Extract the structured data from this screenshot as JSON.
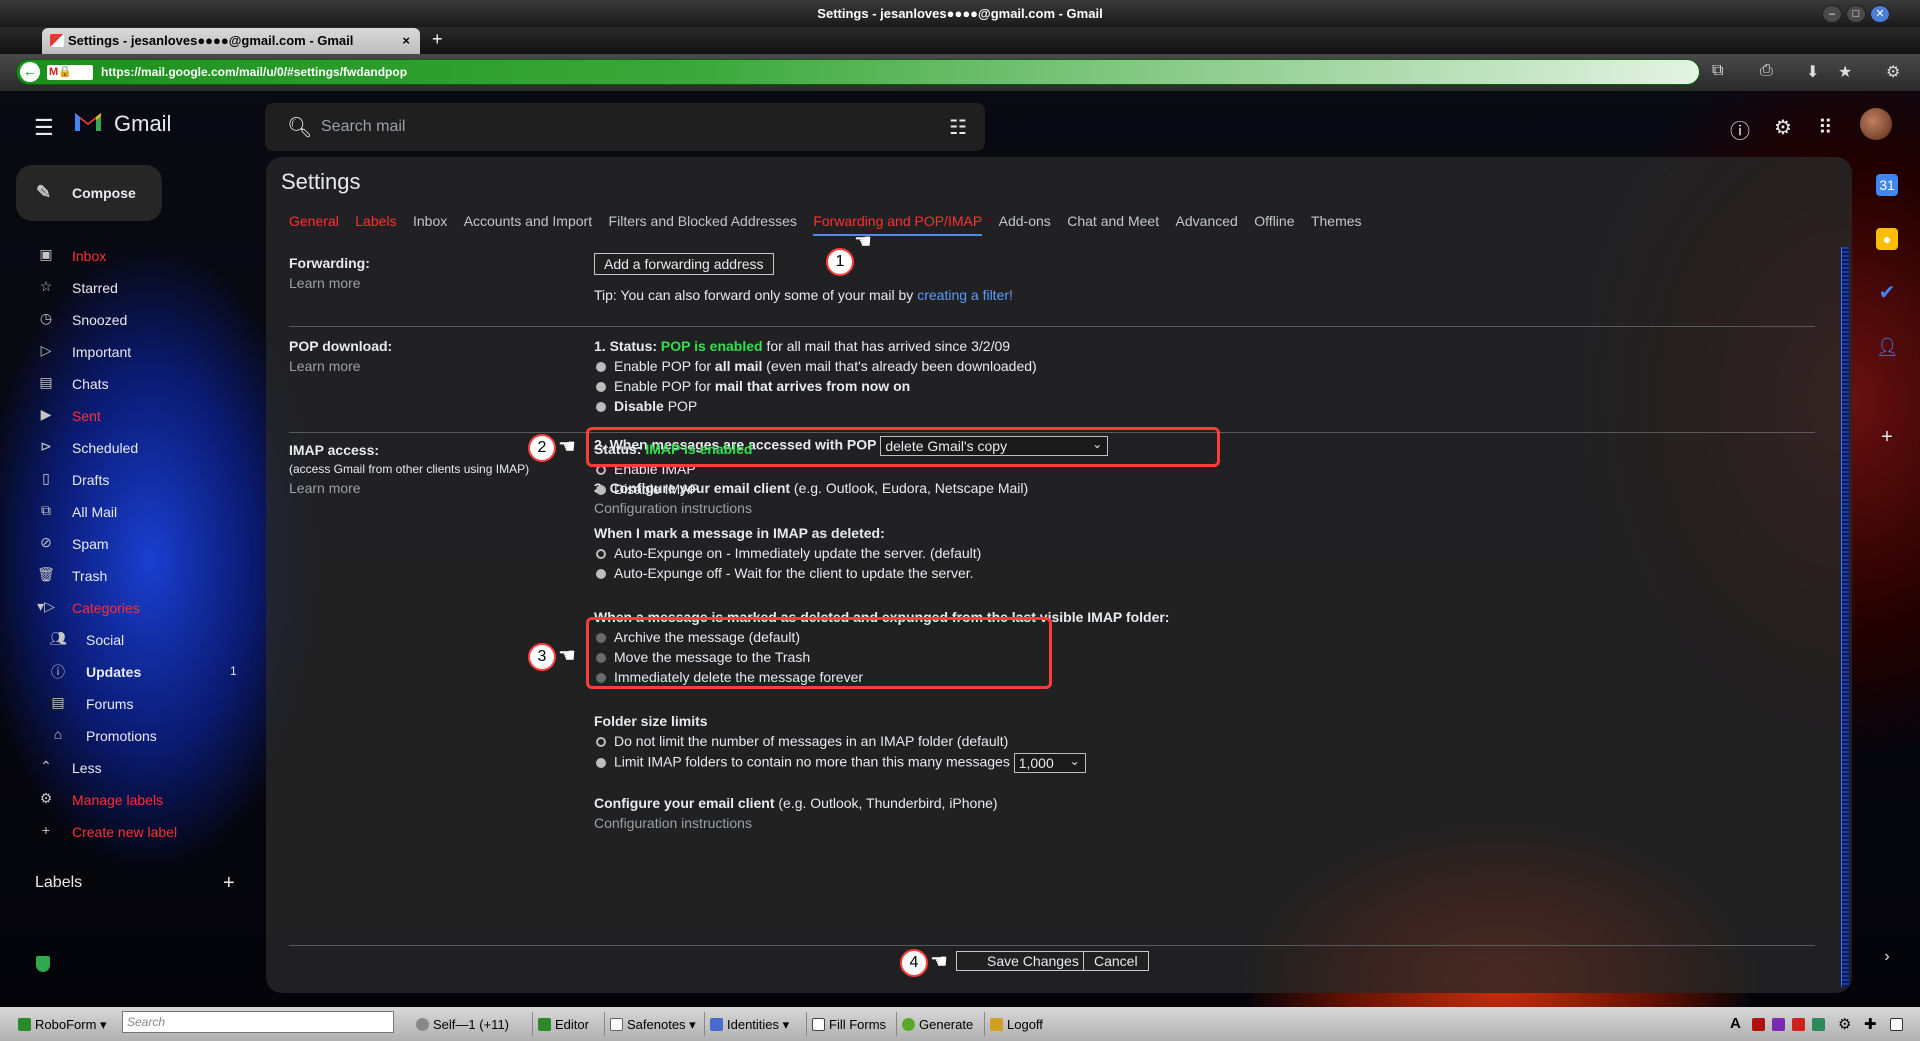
{
  "window": {
    "title": "Settings - jesanloves●●●●@gmail.com - Gmail"
  },
  "browser": {
    "tab_title": "Settings - jesanloves●●●●@gmail.com - Gmail",
    "tab_close": "×",
    "new_tab": "+",
    "url": "https://mail.google.com/mail/u/0/#settings/fwdandpop"
  },
  "gmail": {
    "brand": "Gmail",
    "search_placeholder": "Search mail",
    "compose": "Compose"
  },
  "nav": {
    "items": [
      {
        "label": "Inbox",
        "icon": "inbox-icon"
      },
      {
        "label": "Starred",
        "icon": "star-icon"
      },
      {
        "label": "Snoozed",
        "icon": "clock-icon"
      },
      {
        "label": "Important",
        "icon": "important-icon"
      },
      {
        "label": "Chats",
        "icon": "chat-icon"
      },
      {
        "label": "Sent",
        "icon": "send-icon"
      },
      {
        "label": "Scheduled",
        "icon": "scheduled-send-icon"
      },
      {
        "label": "Drafts",
        "icon": "draft-icon"
      },
      {
        "label": "All Mail",
        "icon": "all-mail-icon"
      },
      {
        "label": "Spam",
        "icon": "spam-icon"
      },
      {
        "label": "Trash",
        "icon": "trash-icon"
      },
      {
        "label": "Categories",
        "icon": "label-icon"
      },
      {
        "label": "Social",
        "icon": "people-icon"
      },
      {
        "label": "Updates",
        "icon": "info-icon",
        "count": "1"
      },
      {
        "label": "Forums",
        "icon": "forum-icon"
      },
      {
        "label": "Promotions",
        "icon": "tag-icon"
      },
      {
        "label": "Less",
        "icon": "chevron-up-icon"
      },
      {
        "label": "Manage labels",
        "icon": "gear-icon"
      },
      {
        "label": "Create new label",
        "icon": "plus-icon"
      }
    ],
    "labels_heading": "Labels"
  },
  "settings": {
    "title": "Settings",
    "tabs": [
      "General",
      "Labels",
      "Inbox",
      "Accounts and Import",
      "Filters and Blocked Addresses",
      "Forwarding and POP/IMAP",
      "Add-ons",
      "Chat and Meet",
      "Advanced",
      "Offline",
      "Themes"
    ],
    "forwarding": {
      "heading": "Forwarding:",
      "learn_more": "Learn more",
      "add_button": "Add a forwarding address",
      "tip_prefix": "Tip: You can also forward only some of your mail by ",
      "tip_link": "creating a filter!"
    },
    "pop": {
      "heading": "POP download:",
      "learn_more": "Learn more",
      "status_label": "1. Status: ",
      "status_value": "POP is enabled",
      "status_suffix": " for all mail that has arrived since 3/2/09",
      "opt1_prefix": "Enable POP for ",
      "opt1_bold": "all mail",
      "opt1_suffix": " (even mail that's already been downloaded)",
      "opt2_prefix": "Enable POP for ",
      "opt2_bold": "mail that arrives from now on",
      "opt3": "Disable",
      "opt3_suffix": " POP",
      "access_label": "2. When messages are accessed with POP",
      "access_value": "delete Gmail's copy",
      "configure_label": "3. Configure your email client",
      "configure_suffix": " (e.g. Outlook, Eudora, Netscape Mail)",
      "config_instructions": "Configuration instructions"
    },
    "imap": {
      "heading": "IMAP access:",
      "subheading": "(access Gmail from other clients using IMAP)",
      "learn_more": "Learn more",
      "status_label": "Status: ",
      "status_value": "IMAP is enabled",
      "enable": "Enable IMAP",
      "disable": "Disable IMAP",
      "deleted_heading": "When I mark a message in IMAP as deleted:",
      "expunge_on": "Auto-Expunge on - Immediately update the server. (default)",
      "expunge_off": "Auto-Expunge off - Wait for the client to update the server.",
      "expunged_heading": "When a message is marked as deleted and expunged from the last visible IMAP folder:",
      "archive": "Archive the message (default)",
      "move_trash": "Move the message to the Trash",
      "delete_forever": "Immediately delete the message forever",
      "folder_heading": "Folder size limits",
      "no_limit": "Do not limit the number of messages in an IMAP folder (default)",
      "limit": "Limit IMAP folders to contain no more than this many messages",
      "limit_value": "1,000",
      "configure_label": "Configure your email client",
      "configure_suffix": " (e.g. Outlook, Thunderbird, iPhone)",
      "config_instructions": "Configuration instructions"
    },
    "save": "Save Changes",
    "cancel": "Cancel"
  },
  "annotations": [
    "1",
    "2",
    "3",
    "4"
  ],
  "roboform": {
    "logo": "RoboForm",
    "search_placeholder": "Search",
    "self": "Self—1",
    "self_count": "(+11)",
    "editor": "Editor",
    "safenotes": "Safenotes",
    "identities": "Identities",
    "fill_forms": "Fill Forms",
    "generate": "Generate",
    "logoff": "Logoff"
  },
  "colors": {
    "accent_red": "#ff3030",
    "status_green": "#2fe04c",
    "link_blue": "#5b9cff",
    "highlight": "#ff3b3b"
  }
}
